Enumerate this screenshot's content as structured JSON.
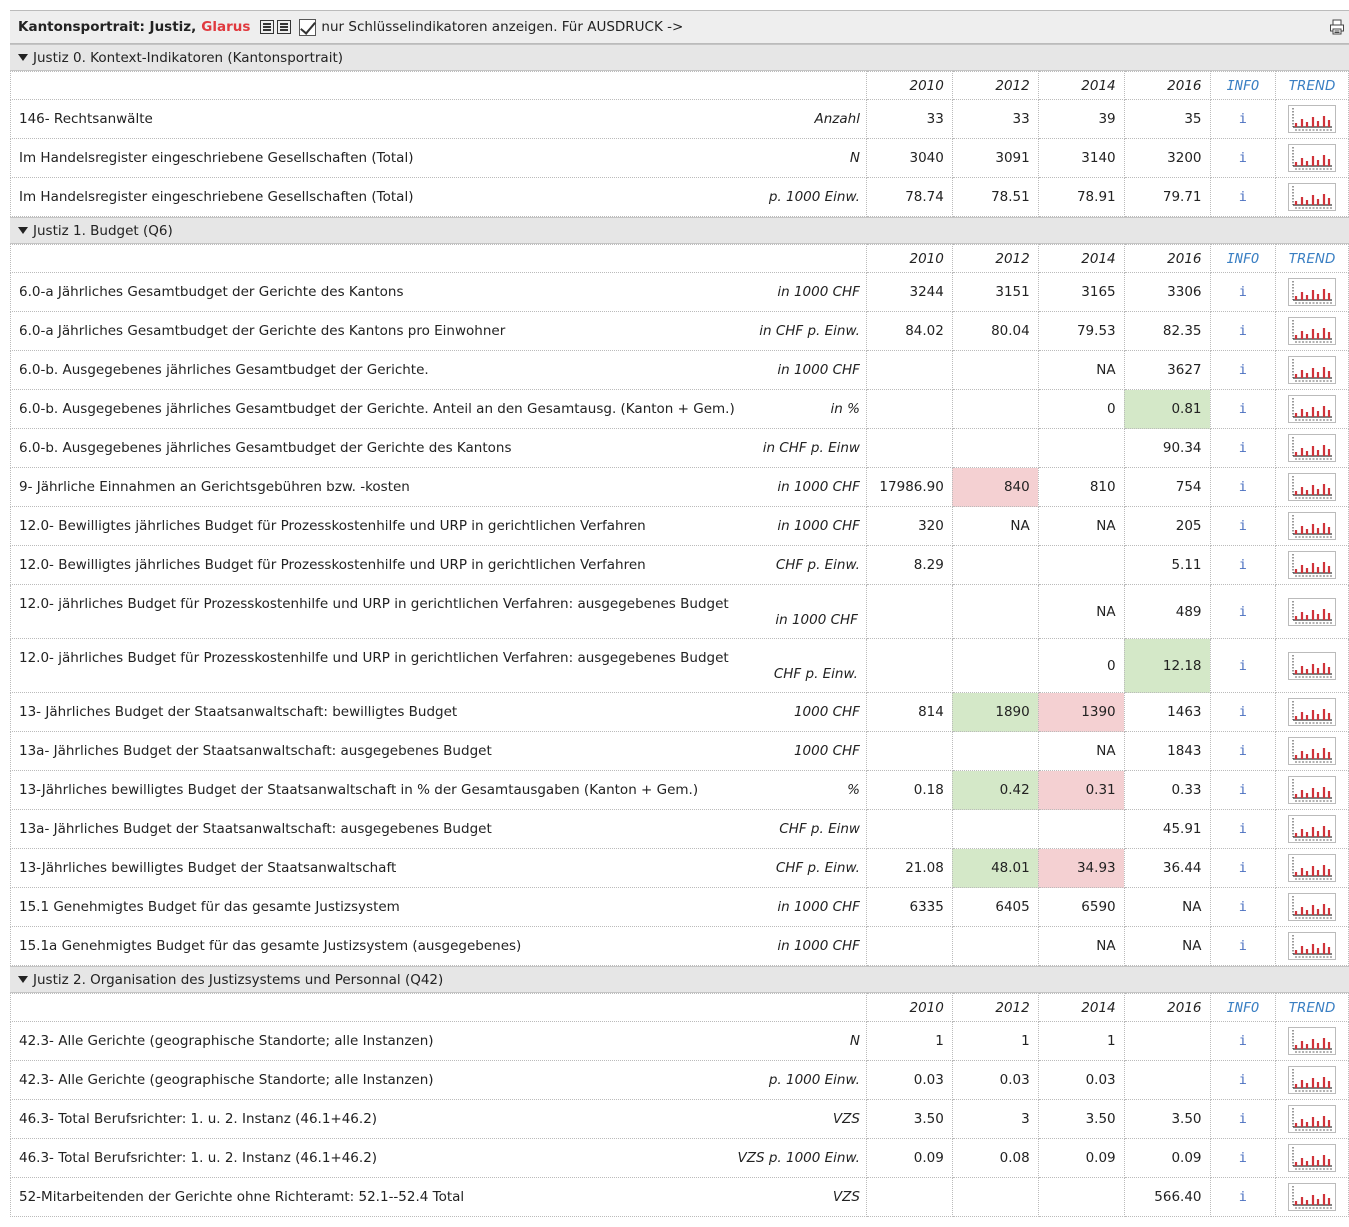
{
  "header": {
    "title": "Kantonsportrait: Justiz,",
    "canton": "Glarus",
    "checkbox_label": "nur Schlüsselindikatoren anzeigen. Für AUSDRUCK ->"
  },
  "col_headers": {
    "y1": "2010",
    "y2": "2012",
    "y3": "2014",
    "y4": "2016",
    "info": "INFO",
    "trend": "TREND"
  },
  "sections": [
    {
      "title": "Justiz 0. Kontext-Indikatoren (Kantonsportrait)",
      "rows": [
        {
          "label": "146- Rechtsanwälte",
          "unit": "Anzahl",
          "v": [
            "33",
            "33",
            "39",
            "35"
          ],
          "hl": [
            "",
            "",
            "",
            ""
          ]
        },
        {
          "label": "Im Handelsregister eingeschriebene Gesellschaften (Total)",
          "unit": "N",
          "v": [
            "3040",
            "3091",
            "3140",
            "3200"
          ],
          "hl": [
            "",
            "",
            "",
            ""
          ]
        },
        {
          "label": "Im Handelsregister eingeschriebene Gesellschaften (Total)",
          "unit": "p. 1000 Einw.",
          "v": [
            "78.74",
            "78.51",
            "78.91",
            "79.71"
          ],
          "hl": [
            "",
            "",
            "",
            ""
          ]
        }
      ]
    },
    {
      "title": "Justiz 1. Budget (Q6)",
      "rows": [
        {
          "label": "6.0-a Jährliches Gesamtbudget der Gerichte des Kantons",
          "unit": "in 1000 CHF",
          "v": [
            "3244",
            "3151",
            "3165",
            "3306"
          ],
          "hl": [
            "",
            "",
            "",
            ""
          ]
        },
        {
          "label": "6.0-a Jährliches Gesamtbudget der Gerichte des Kantons pro Einwohner",
          "unit": "in CHF p. Einw.",
          "v": [
            "84.02",
            "80.04",
            "79.53",
            "82.35"
          ],
          "hl": [
            "",
            "",
            "",
            ""
          ]
        },
        {
          "label": "6.0-b. Ausgegebenes jährliches Gesamtbudget der Gerichte.",
          "unit": "in 1000 CHF",
          "v": [
            "",
            "",
            "NA",
            "3627"
          ],
          "hl": [
            "",
            "",
            "",
            ""
          ]
        },
        {
          "label": "6.0-b. Ausgegebenes jährliches Gesamtbudget der Gerichte. Anteil an den Gesamtausg. (Kanton + Gem.)",
          "unit": "in %",
          "v": [
            "",
            "",
            "0",
            "0.81"
          ],
          "hl": [
            "",
            "",
            "",
            "green"
          ]
        },
        {
          "label": "6.0-b. Ausgegebenes jährliches Gesamtbudget der Gerichte des Kantons",
          "unit": "in CHF p. Einw",
          "v": [
            "",
            "",
            "",
            "90.34"
          ],
          "hl": [
            "",
            "",
            "",
            ""
          ]
        },
        {
          "label": "9- Jährliche Einnahmen an Gerichtsgebühren bzw. -kosten",
          "unit": "in 1000 CHF",
          "v": [
            "17986.90",
            "840",
            "810",
            "754"
          ],
          "hl": [
            "",
            "red",
            "",
            ""
          ]
        },
        {
          "label": "12.0- Bewilligtes jährliches Budget für Prozesskostenhilfe und URP in gerichtlichen Verfahren",
          "unit": "in 1000 CHF",
          "v": [
            "320",
            "NA",
            "NA",
            "205"
          ],
          "hl": [
            "",
            "",
            "",
            ""
          ]
        },
        {
          "label": "12.0- Bewilligtes jährliches Budget für Prozesskostenhilfe und URP in gerichtlichen Verfahren",
          "unit": "CHF p. Einw.",
          "v": [
            "8.29",
            "",
            "",
            "5.11"
          ],
          "hl": [
            "",
            "",
            "",
            ""
          ]
        },
        {
          "label": "12.0- jährliches Budget für Prozesskostenhilfe und URP in gerichtlichen Verfahren: ausgegebenes Budget",
          "unit": "in 1000 CHF",
          "v": [
            "",
            "",
            "NA",
            "489"
          ],
          "hl": [
            "",
            "",
            "",
            ""
          ],
          "wrap": true
        },
        {
          "label": "12.0- jährliches Budget für Prozesskostenhilfe und URP in gerichtlichen Verfahren: ausgegebenes Budget",
          "unit": "CHF p. Einw.",
          "v": [
            "",
            "",
            "0",
            "12.18"
          ],
          "hl": [
            "",
            "",
            "",
            "green"
          ],
          "wrap": true
        },
        {
          "label": "13- Jährliches Budget der Staatsanwaltschaft: bewilligtes Budget",
          "unit": "1000 CHF",
          "v": [
            "814",
            "1890",
            "1390",
            "1463"
          ],
          "hl": [
            "",
            "green",
            "red",
            ""
          ]
        },
        {
          "label": "13a- Jährliches Budget der Staatsanwaltschaft: ausgegebenes Budget",
          "unit": "1000 CHF",
          "v": [
            "",
            "",
            "NA",
            "1843"
          ],
          "hl": [
            "",
            "",
            "",
            ""
          ]
        },
        {
          "label": "13-Jährliches bewilligtes Budget der Staatsanwaltschaft in % der Gesamtausgaben (Kanton + Gem.)",
          "unit": "%",
          "v": [
            "0.18",
            "0.42",
            "0.31",
            "0.33"
          ],
          "hl": [
            "",
            "green",
            "red",
            ""
          ]
        },
        {
          "label": "13a- Jährliches Budget der Staatsanwaltschaft: ausgegebenes Budget",
          "unit": "CHF p. Einw",
          "v": [
            "",
            "",
            "",
            "45.91"
          ],
          "hl": [
            "",
            "",
            "",
            ""
          ]
        },
        {
          "label": "13-Jährliches bewilligtes Budget der Staatsanwaltschaft",
          "unit": "CHF p. Einw.",
          "v": [
            "21.08",
            "48.01",
            "34.93",
            "36.44"
          ],
          "hl": [
            "",
            "green",
            "red",
            ""
          ]
        },
        {
          "label": "15.1 Genehmigtes Budget für das gesamte Justizsystem",
          "unit": "in 1000 CHF",
          "v": [
            "6335",
            "6405",
            "6590",
            "NA"
          ],
          "hl": [
            "",
            "",
            "",
            ""
          ]
        },
        {
          "label": "15.1a Genehmigtes Budget für das gesamte Justizsystem (ausgegebenes)",
          "unit": "in 1000 CHF",
          "v": [
            "",
            "",
            "NA",
            "NA"
          ],
          "hl": [
            "",
            "",
            "",
            ""
          ]
        }
      ]
    },
    {
      "title": "Justiz 2. Organisation des Justizsystems und Personnal (Q42)",
      "rows": [
        {
          "label": "42.3- Alle Gerichte (geographische Standorte; alle Instanzen)",
          "unit": "N",
          "v": [
            "1",
            "1",
            "1",
            ""
          ],
          "hl": [
            "",
            "",
            "",
            ""
          ]
        },
        {
          "label": "42.3- Alle Gerichte (geographische Standorte; alle Instanzen)",
          "unit": "p. 1000 Einw.",
          "v": [
            "0.03",
            "0.03",
            "0.03",
            ""
          ],
          "hl": [
            "",
            "",
            "",
            ""
          ]
        },
        {
          "label": "46.3- Total Berufsrichter: 1. u. 2. Instanz (46.1+46.2)",
          "unit": "VZS",
          "v": [
            "3.50",
            "3",
            "3.50",
            "3.50"
          ],
          "hl": [
            "",
            "",
            "",
            ""
          ]
        },
        {
          "label": "46.3- Total Berufsrichter: 1. u. 2. Instanz (46.1+46.2)",
          "unit": "VZS p. 1000 Einw.",
          "v": [
            "0.09",
            "0.08",
            "0.09",
            "0.09"
          ],
          "hl": [
            "",
            "",
            "",
            ""
          ]
        },
        {
          "label": "52-Mitarbeitenden der Gerichte ohne Richteramt: 52.1--52.4 Total",
          "unit": "VZS",
          "v": [
            "",
            "",
            "",
            "566.40"
          ],
          "hl": [
            "",
            "",
            "",
            ""
          ]
        }
      ]
    }
  ],
  "info_glyph": "i",
  "colors": {
    "green": "#d4e8c8",
    "red": "#f4d0d2",
    "canton": "#e0393e",
    "link": "#3a7fc3"
  },
  "icons": [
    "list-view-icon",
    "detail-view-icon",
    "checkbox-icon",
    "printer-icon",
    "trend-chart-icon",
    "triangle-down-icon"
  ]
}
